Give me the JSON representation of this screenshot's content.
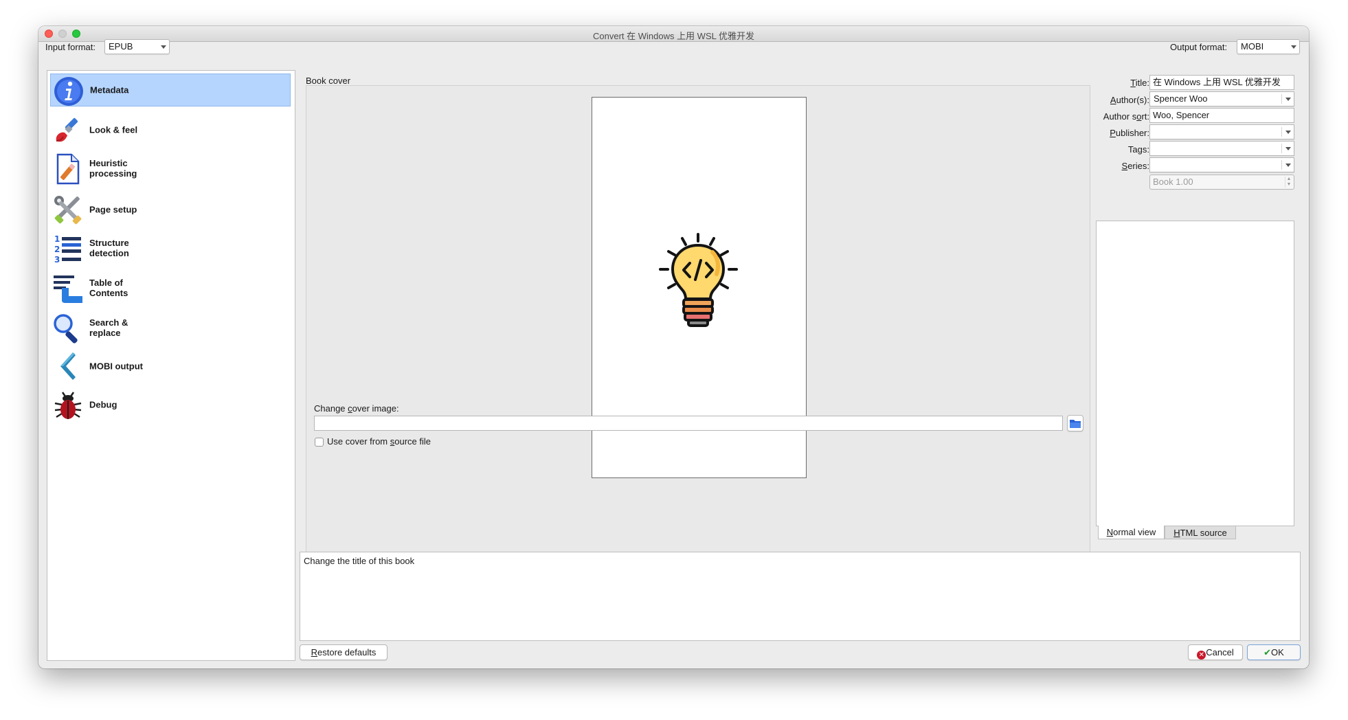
{
  "window": {
    "title": "Convert 在 Windows 上用 WSL 优雅开发"
  },
  "input_format": {
    "label": "Input format:",
    "value": "EPUB"
  },
  "output_format": {
    "label": "Output format:",
    "value": "MOBI"
  },
  "sidebar": {
    "items": [
      {
        "label": "Metadata",
        "icon": "info-icon"
      },
      {
        "label": "Look & feel",
        "icon": "paintbrush-icon"
      },
      {
        "label": "Heuristic processing",
        "icon": "heuristic-document-icon"
      },
      {
        "label": "Page setup",
        "icon": "tools-icon"
      },
      {
        "label": "Structure detection",
        "icon": "numbered-list-icon"
      },
      {
        "label": "Table of Contents",
        "icon": "toc-icon"
      },
      {
        "label": "Search & replace",
        "icon": "magnifier-icon"
      },
      {
        "label": "MOBI output",
        "icon": "chevron-left-icon"
      },
      {
        "label": "Debug",
        "icon": "bug-icon"
      }
    ]
  },
  "cover": {
    "group_label": "Book cover",
    "change_label": "Change cover image:",
    "path_value": "",
    "use_source_label": "Use cover from source file",
    "use_source_checked": false
  },
  "metadata": {
    "title_label": "Title:",
    "title_value": "在 Windows 上用 WSL 优雅开发",
    "authors_label": "Author(s):",
    "authors_value": "Spencer Woo",
    "author_sort_label": "Author sort:",
    "author_sort_value": "Woo, Spencer",
    "publisher_label": "Publisher:",
    "publisher_value": "",
    "tags_label": "Tags:",
    "tags_value": "",
    "series_label": "Series:",
    "series_value": "",
    "series_index": "Book 1.00"
  },
  "comments_tabs": {
    "normal": "Normal view",
    "html": "HTML source"
  },
  "help_text": "Change the title of this book",
  "buttons": {
    "restore": "Restore defaults",
    "cancel": "Cancel",
    "ok": "OK"
  },
  "colors": {
    "selection": "#b5d5ff",
    "accent": "#1f6fd1",
    "bulb": "#ffd86e"
  }
}
